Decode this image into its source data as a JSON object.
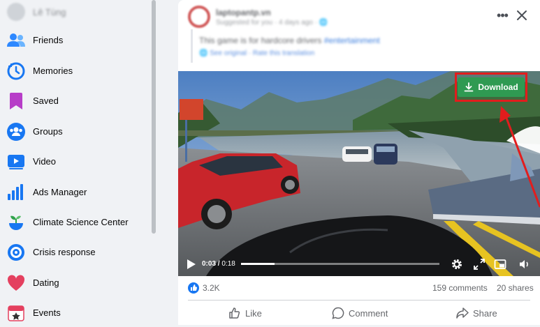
{
  "sidebar": {
    "profile_name": "Lê Tùng",
    "items": [
      {
        "label": "Friends",
        "icon": "friends-icon"
      },
      {
        "label": "Memories",
        "icon": "memories-icon"
      },
      {
        "label": "Saved",
        "icon": "saved-icon"
      },
      {
        "label": "Groups",
        "icon": "groups-icon"
      },
      {
        "label": "Video",
        "icon": "video-icon"
      },
      {
        "label": "Ads Manager",
        "icon": "ads-manager-icon"
      },
      {
        "label": "Climate Science Center",
        "icon": "climate-icon"
      },
      {
        "label": "Crisis response",
        "icon": "crisis-icon"
      },
      {
        "label": "Dating",
        "icon": "dating-icon"
      },
      {
        "label": "Events",
        "icon": "events-icon"
      }
    ]
  },
  "post": {
    "author": "laptopantp.vn",
    "meta": "Suggested for you · 4 days ago · 🌐",
    "text": "This game is for hardcore drivers",
    "hashtag": "#entertainment",
    "translate_line": "🌐 See original · Rate this translation"
  },
  "video": {
    "time_current": "0:03",
    "time_total": "0:18",
    "progress": 0.17,
    "download_label": "Download"
  },
  "stats": {
    "likes": "3.2K",
    "comments": "159 comments",
    "shares": "20 shares"
  },
  "actions": {
    "like": "Like",
    "comment": "Comment",
    "share": "Share"
  },
  "colors": {
    "accent": "#1877f2",
    "download_green": "#2f9a52",
    "highlight_red": "#e21d1d"
  }
}
